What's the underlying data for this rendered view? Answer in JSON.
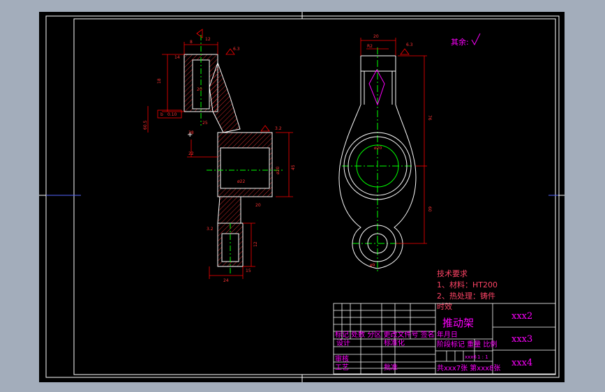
{
  "colors": {
    "background": "#a3adbb",
    "sheet": "#000000",
    "frame": "#ffffff",
    "outline": "#ffffff",
    "dimension": "#ff0000",
    "centerline": "#00ff00",
    "text_magenta": "#ff00ff",
    "text_red": "#ff0000",
    "text_yellow": "#ffff00"
  },
  "drawing": {
    "roughness_note": "其余:",
    "tech_requirements": {
      "title": "技术要求",
      "line1": "1、材料：HT200",
      "line2": "2、热处理：铸件",
      "line3": "时效"
    },
    "dims": {
      "d1": "12",
      "d2": "8",
      "d3": "6.3",
      "d4": "14",
      "d5": "18",
      "d6": "60.5",
      "d7": "20",
      "d8": "25",
      "d9": "3.2",
      "d10": "38",
      "d11": "22",
      "d12": "0.10",
      "d13": "b",
      "d14": "45",
      "d15": "20",
      "d16": "ø20",
      "d17": "ø22",
      "d18": "76",
      "d19": "60",
      "d20": "3.2",
      "d21": "R2",
      "d22": "ø9",
      "d23": "12",
      "d24": "24",
      "d25": "15"
    }
  },
  "title_block": {
    "part_name": "推动架",
    "label_school": "xxx2",
    "label_drawing_no": "xxx3",
    "label_company": "xxx4",
    "row_revision": "标记 处数 分区 更改文件号 签名 年月日",
    "design": "设计",
    "standardize": "标准化",
    "stage_weight_scale": "阶段标记 重量 比例",
    "check": "审核",
    "process": "工艺",
    "approve": "批准",
    "scale_value": "1 : 1",
    "mass_value": "xxx6",
    "sheets": "共xxx7张 第xxx8张"
  }
}
